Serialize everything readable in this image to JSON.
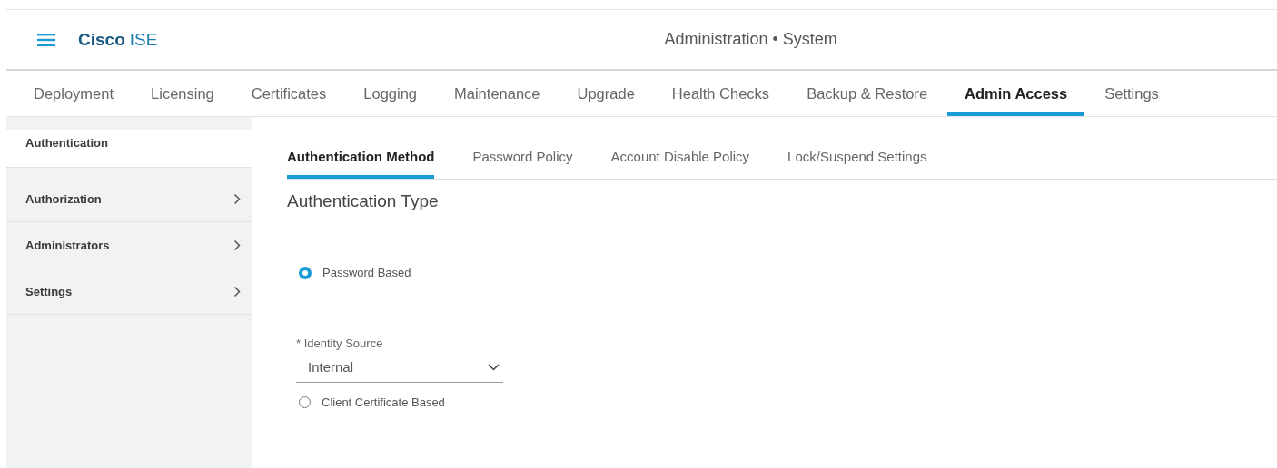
{
  "header": {
    "brand_bold": "Cisco",
    "brand_light": "ISE",
    "title": "Administration • System"
  },
  "tabs": [
    {
      "label": "Deployment",
      "selected": false
    },
    {
      "label": "Licensing",
      "selected": false
    },
    {
      "label": "Certificates",
      "selected": false
    },
    {
      "label": "Logging",
      "selected": false
    },
    {
      "label": "Maintenance",
      "selected": false
    },
    {
      "label": "Upgrade",
      "selected": false
    },
    {
      "label": "Health Checks",
      "selected": false
    },
    {
      "label": "Backup & Restore",
      "selected": false
    },
    {
      "label": "Admin Access",
      "selected": true
    },
    {
      "label": "Settings",
      "selected": false
    }
  ],
  "sidebar": {
    "items": [
      {
        "label": "Authentication",
        "selected": true,
        "expandable": false
      },
      {
        "label": "Authorization",
        "selected": false,
        "expandable": true
      },
      {
        "label": "Administrators",
        "selected": false,
        "expandable": true
      },
      {
        "label": "Settings",
        "selected": false,
        "expandable": true
      }
    ]
  },
  "subtabs": [
    {
      "label": "Authentication Method",
      "selected": true
    },
    {
      "label": "Password Policy",
      "selected": false
    },
    {
      "label": "Account Disable Policy",
      "selected": false
    },
    {
      "label": "Lock/Suspend Settings",
      "selected": false
    }
  ],
  "section_title": "Authentication Type",
  "options": [
    {
      "label": "Password Based",
      "selected": true
    },
    {
      "label": "Client Certificate Based",
      "selected": false
    }
  ],
  "identity_source": {
    "label": "* Identity Source",
    "value": "Internal"
  }
}
